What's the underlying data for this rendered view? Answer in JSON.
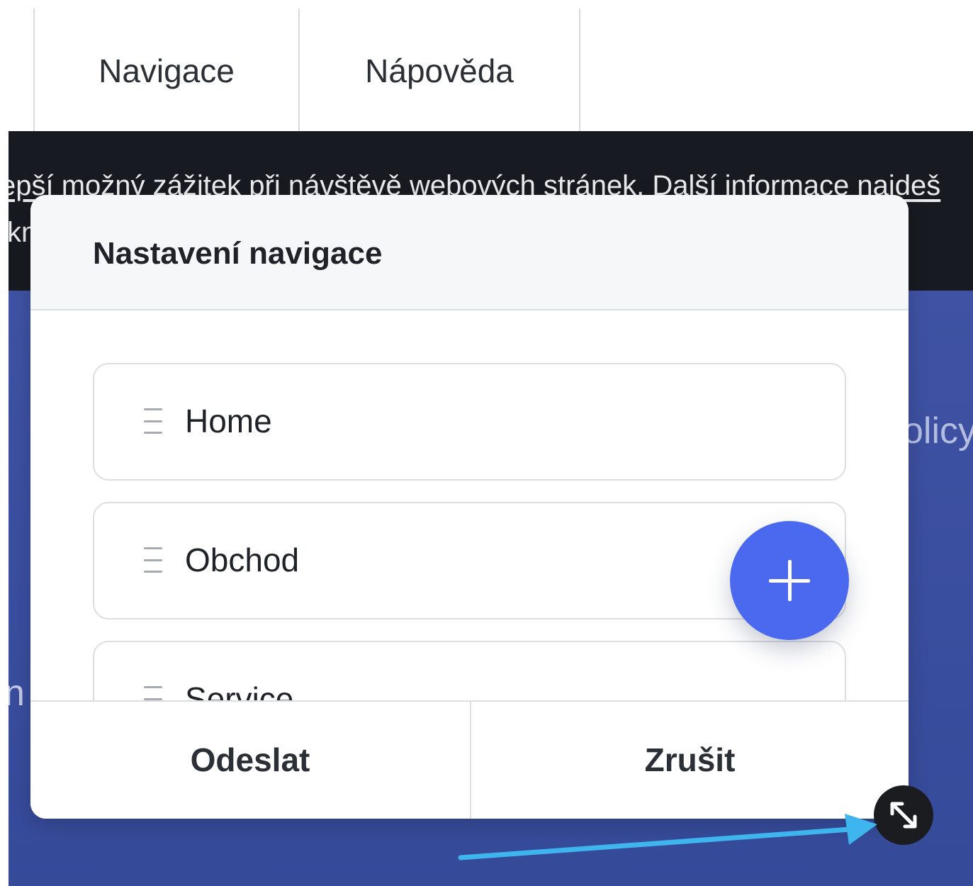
{
  "top_nav": {
    "tabs": [
      {
        "label": "Navigace"
      },
      {
        "label": "Nápověda"
      }
    ]
  },
  "cookie_banner": {
    "line1": "epší možný zážitek při návštěvě webových stránek. Další informace najdeš",
    "line2": "kn"
  },
  "background": {
    "right_fragment": "olicy",
    "left_fragment": "n"
  },
  "modal": {
    "title": "Nastavení navigace",
    "items": [
      {
        "label": "Home",
        "icon": "drag-handle-icon"
      },
      {
        "label": "Obchod",
        "icon": "drag-handle-icon"
      },
      {
        "label": "Service",
        "icon": "drag-handle-icon"
      }
    ],
    "add_button_icon": "plus-icon",
    "submit_label": "Odeslat",
    "cancel_label": "Zrušit",
    "resize_icon": "resize-diagonal-icon"
  },
  "colors": {
    "accent": "#4a69ee",
    "banner_bg": "#171b21",
    "hero_bg": "#3b4fa0",
    "annotation_arrow": "#3fb5ee"
  }
}
